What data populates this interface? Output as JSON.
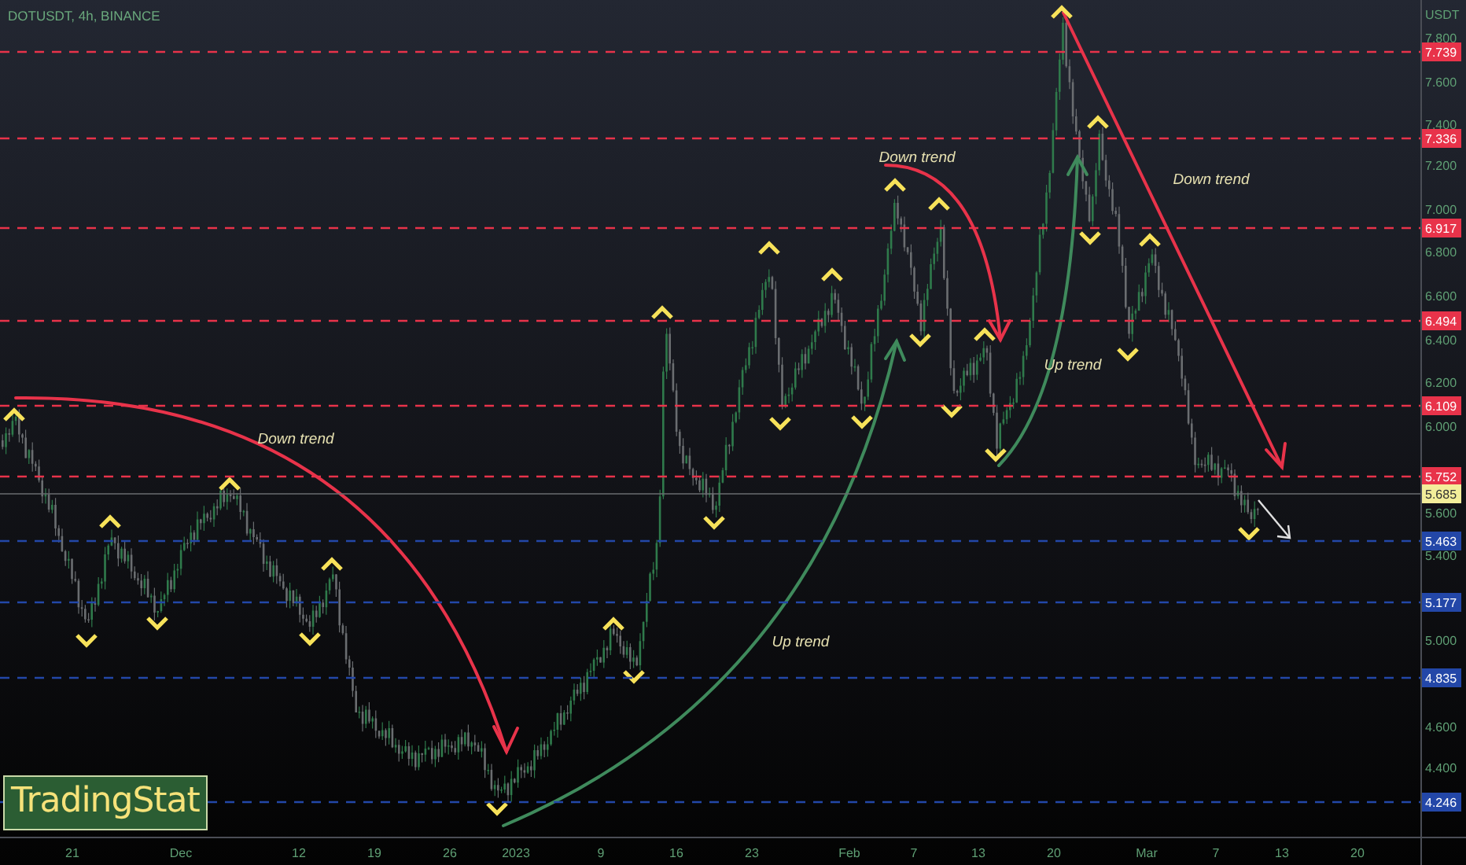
{
  "symbol_title": "DOTUSDT, 4h, BINANCE",
  "price_axis": {
    "currency": "USDT",
    "ticks": [
      "7.800",
      "7.600",
      "7.400",
      "7.200",
      "7.000",
      "6.800",
      "6.600",
      "6.400",
      "6.200",
      "6.000",
      "5.600",
      "5.400",
      "5.000",
      "4.600",
      "4.400"
    ]
  },
  "levels": [
    {
      "label": "7.739",
      "color": "#e8334a"
    },
    {
      "label": "7.336",
      "color": "#e8334a"
    },
    {
      "label": "6.917",
      "color": "#e8334a"
    },
    {
      "label": "6.494",
      "color": "#e8334a"
    },
    {
      "label": "6.109",
      "color": "#e8334a"
    },
    {
      "label": "5.752",
      "color": "#e8334a"
    },
    {
      "label": "5.463",
      "color": "#2347a8"
    },
    {
      "label": "5.177",
      "color": "#2347a8"
    },
    {
      "label": "4.835",
      "color": "#2347a8"
    },
    {
      "label": "4.246",
      "color": "#2347a8"
    }
  ],
  "current_price": {
    "label": "5.685"
  },
  "annotations": [
    {
      "text": "Down trend"
    },
    {
      "text": "Down trend"
    },
    {
      "text": "Up trend"
    },
    {
      "text": "Down trend"
    },
    {
      "text": "Up trend"
    }
  ],
  "time_axis": {
    "ticks": [
      "21",
      "Dec",
      "12",
      "19",
      "26",
      "2023",
      "9",
      "16",
      "23",
      "Feb",
      "7",
      "13",
      "20",
      "Mar",
      "7",
      "13",
      "20"
    ]
  },
  "logo": {
    "text": "TradingStat"
  }
}
